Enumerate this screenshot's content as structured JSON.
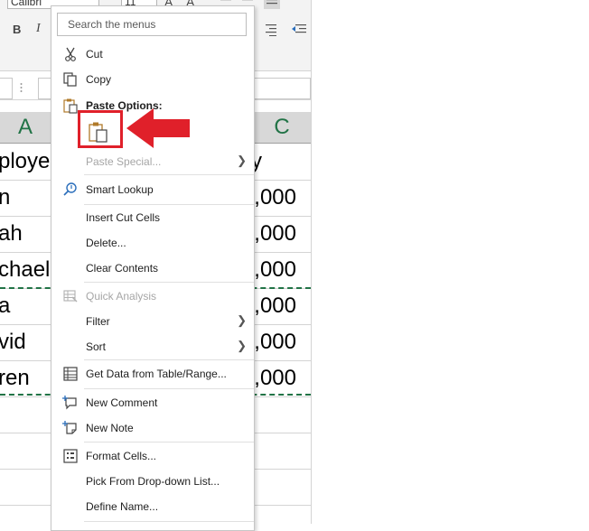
{
  "ribbon": {
    "font_name": "Calibri",
    "font_size": "11",
    "bold": "B",
    "italic": "I",
    "grow_font": "A",
    "shrink_font": "A"
  },
  "columns": [
    "A",
    "C"
  ],
  "rows": [
    {
      "a": "ployee",
      "c": "y"
    },
    {
      "a": "n",
      "c": ",000"
    },
    {
      "a": "ah",
      "c": ",000"
    },
    {
      "a": "chael",
      "c": ",000"
    },
    {
      "a": "a",
      "c": ",000"
    },
    {
      "a": "vid",
      "c": ",000"
    },
    {
      "a": "ren",
      "c": ",000"
    }
  ],
  "menu": {
    "search_placeholder": "Search the menus",
    "cut": "Cut",
    "copy": "Copy",
    "paste_options": "Paste Options:",
    "paste_special": "Paste Special...",
    "smart_lookup": "Smart Lookup",
    "insert_cut_cells": "Insert Cut Cells",
    "delete": "Delete...",
    "clear_contents": "Clear Contents",
    "quick_analysis": "Quick Analysis",
    "filter": "Filter",
    "sort": "Sort",
    "get_data": "Get Data from Table/Range...",
    "new_comment": "New Comment",
    "new_note": "New Note",
    "format_cells": "Format Cells...",
    "pick_from_list": "Pick From Drop-down List...",
    "define_name": "Define Name..."
  },
  "colors": {
    "excel_green": "#217346",
    "highlight_red": "#e0202a"
  }
}
